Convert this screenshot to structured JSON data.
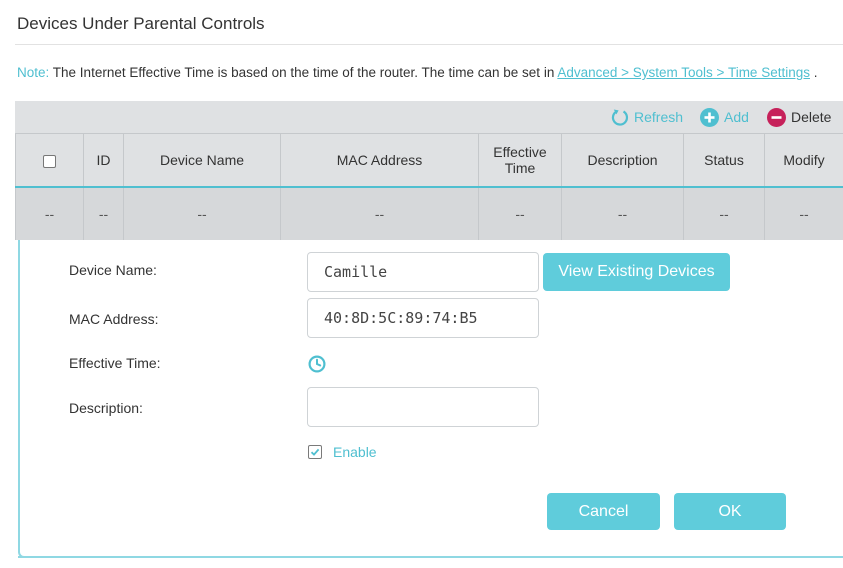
{
  "page_title": "Devices Under Parental Controls",
  "note": {
    "label": "Note:",
    "text": "The Internet Effective Time is based on the time of the router. The time can be set in",
    "link": "Advanced > System Tools > Time Settings",
    "trailing": "."
  },
  "toolbar": {
    "refresh_label": "Refresh",
    "add_label": "Add",
    "delete_label": "Delete",
    "accent_color": "#4fbfd0",
    "delete_color": "#c6215a"
  },
  "table": {
    "columns": [
      "ID",
      "Device Name",
      "MAC Address",
      "Effective Time",
      "Description",
      "Status",
      "Modify"
    ],
    "rows": [
      [
        "--",
        "--",
        "--",
        "--",
        "--",
        "--",
        "--",
        "--"
      ]
    ]
  },
  "form": {
    "device_name_label": "Device Name:",
    "device_name_value": "Camille",
    "view_devices_label": "View Existing Devices",
    "mac_label": "MAC Address:",
    "mac_value": "40:8D:5C:89:74:B5",
    "effective_time_label": "Effective Time:",
    "effective_time_icon": "clock-icon",
    "description_label": "Description:",
    "description_value": "",
    "enable_label": "Enable",
    "enable_checked": true,
    "cancel_label": "Cancel",
    "ok_label": "OK"
  }
}
